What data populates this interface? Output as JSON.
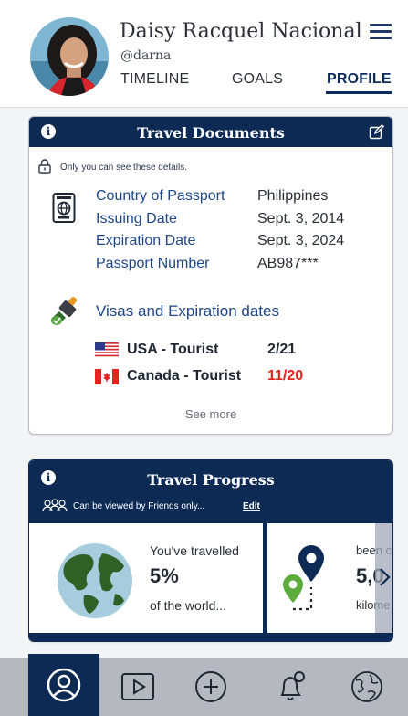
{
  "profile": {
    "name": "Daisy Racquel Nacional",
    "handle": "@darna"
  },
  "tabs": [
    {
      "label": "TIMELINE",
      "active": false
    },
    {
      "label": "GOALS",
      "active": false
    },
    {
      "label": "PROFILE",
      "active": true
    }
  ],
  "travel_documents": {
    "title": "Travel Documents",
    "privacy_note": "Only you can see these details.",
    "passport": {
      "labels": [
        "Country of Passport",
        "Issuing Date",
        "Expiration Date",
        "Passport Number"
      ],
      "values": [
        "Philippines",
        "Sept. 3, 2014",
        "Sept. 3, 2024",
        "AB987***"
      ]
    },
    "visas_title": "Visas and Expiration dates",
    "visas": [
      {
        "name": "USA - Tourist",
        "date": "2/21",
        "date_color": "#1f2733"
      },
      {
        "name": "Canada - Tourist",
        "date": "11/20",
        "date_color": "#e8231f"
      }
    ],
    "see_more": "See more"
  },
  "travel_progress": {
    "title": "Travel Progress",
    "privacy_note": "Can be viewed by Friends only...",
    "edit_label": "Edit",
    "stats": [
      {
        "prefix": "You've travelled",
        "value": "5%",
        "suffix": "of the world..."
      },
      {
        "prefix": "been c",
        "value": "5,0",
        "suffix": "kilome"
      }
    ]
  },
  "bottom_nav": [
    {
      "icon": "profile-icon",
      "active": true
    },
    {
      "icon": "video-play-icon",
      "active": false
    },
    {
      "icon": "add-icon",
      "active": false
    },
    {
      "icon": "notification-bell-icon",
      "active": false
    },
    {
      "icon": "globe-icon",
      "active": false
    }
  ],
  "colors": {
    "navy": "#0d2a55",
    "link_blue": "#1d4689",
    "alert_red": "#e8231f",
    "nav_bar": "#b5b9bf"
  }
}
